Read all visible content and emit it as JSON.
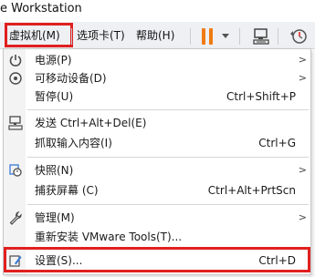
{
  "window": {
    "title": "e Workstation"
  },
  "menubar": {
    "vm": "虚拟机(M)",
    "tabs": "选项卡(T)",
    "help": "帮助(H)"
  },
  "toolbar": {
    "pause_icon": "pause-icon",
    "pause_color": "#f07b12",
    "dropdown_icon": "chevron-down-icon",
    "send_keys_icon": "monitor-keyboard-icon",
    "snapshot_icon": "clock-snapshot-icon"
  },
  "menu": {
    "items": [
      {
        "label": "电源(P)",
        "shortcut": "",
        "submenu": true,
        "icon": "power-icon"
      },
      {
        "label": "可移动设备(D)",
        "shortcut": "",
        "submenu": true,
        "icon": "removable-device-icon"
      },
      {
        "label": "暂停(U)",
        "shortcut": "Ctrl+Shift+P",
        "submenu": false,
        "icon": ""
      },
      {
        "label": "发送 Ctrl+Alt+Del(E)",
        "shortcut": "",
        "submenu": false,
        "icon": "send-keys-icon"
      },
      {
        "label": "抓取输入内容(I)",
        "shortcut": "Ctrl+G",
        "submenu": false,
        "icon": ""
      },
      {
        "label": "快照(N)",
        "shortcut": "",
        "submenu": true,
        "icon": "snapshot-icon"
      },
      {
        "label": "捕获屏幕 (C)",
        "shortcut": "Ctrl+Alt+PrtScn",
        "submenu": false,
        "icon": ""
      },
      {
        "label": "管理(M)",
        "shortcut": "",
        "submenu": true,
        "icon": "wrench-icon"
      },
      {
        "label": "重新安装 VMware Tools(T)...",
        "shortcut": "",
        "submenu": false,
        "icon": ""
      },
      {
        "label": "设置(S)...",
        "shortcut": "Ctrl+D",
        "submenu": false,
        "icon": "settings-icon"
      }
    ],
    "submenu_arrow": ">"
  },
  "highlight_color": "#e0201f"
}
